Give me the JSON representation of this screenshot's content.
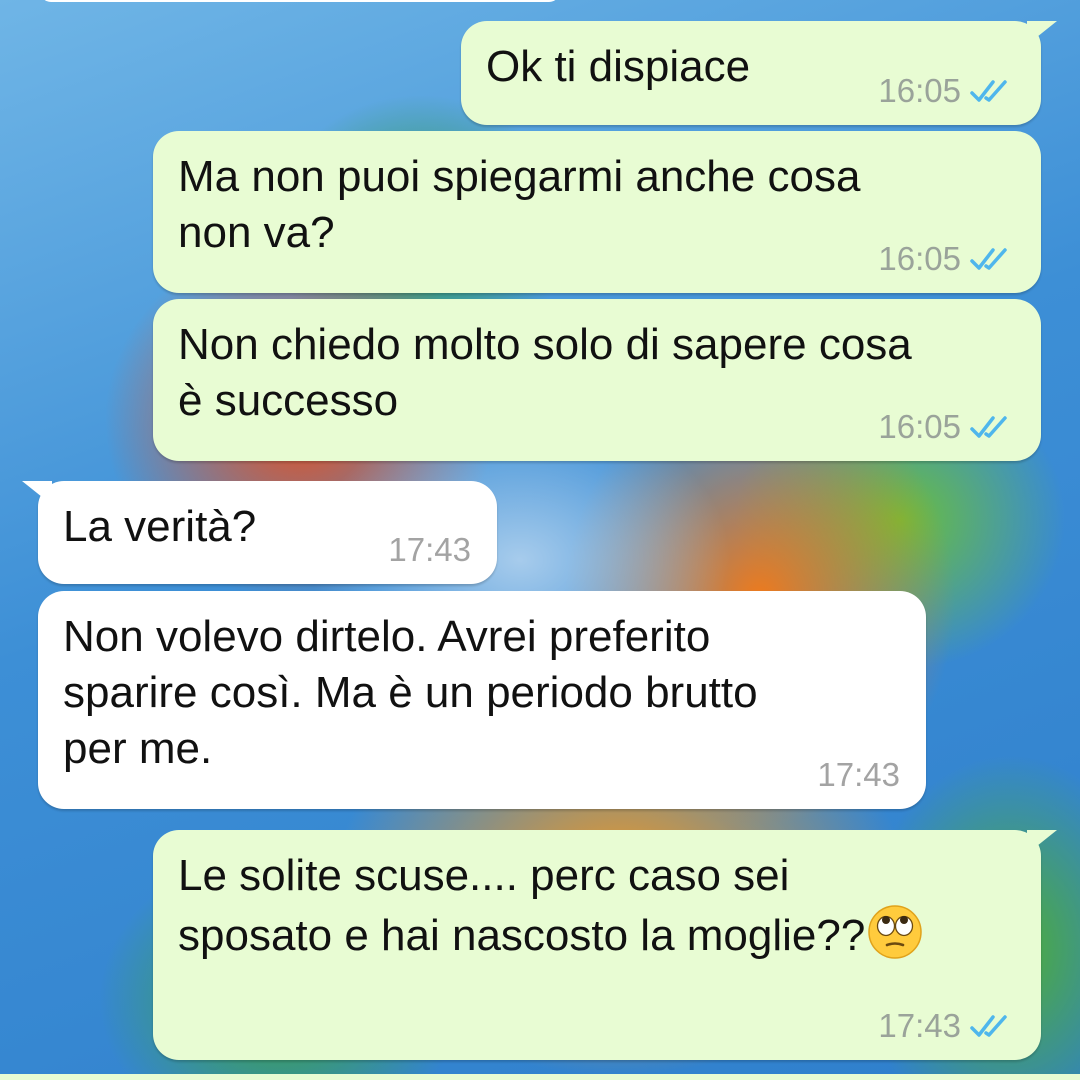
{
  "chat": {
    "messages": [
      {
        "direction": "outgoing",
        "text": "Ok ti dispiace",
        "time": "16:05",
        "status": "read"
      },
      {
        "direction": "outgoing",
        "text": "Ma non puoi spiegarmi anche cosa\nnon va?",
        "time": "16:05",
        "status": "read"
      },
      {
        "direction": "outgoing",
        "text": "Non chiedo molto solo di sapere cosa\nè successo",
        "time": "16:05",
        "status": "read"
      },
      {
        "direction": "incoming",
        "text": "La verità?",
        "time": "17:43"
      },
      {
        "direction": "incoming",
        "text": "Non volevo dirtelo. Avrei preferito\nsparire così. Ma è un periodo brutto\nper me.",
        "time": "17:43"
      },
      {
        "direction": "outgoing",
        "text": "Le solite scuse.... perc caso sei\nsposato e hai nascosto la moglie??",
        "emoji": "face-with-rolling-eyes-icon",
        "time": "17:43",
        "status": "read"
      }
    ]
  },
  "colors": {
    "outgoing_bubble": "#e8fcd3",
    "incoming_bubble": "#ffffff",
    "read_ticks": "#4fb6ec",
    "timestamp": "#9aa39a"
  }
}
